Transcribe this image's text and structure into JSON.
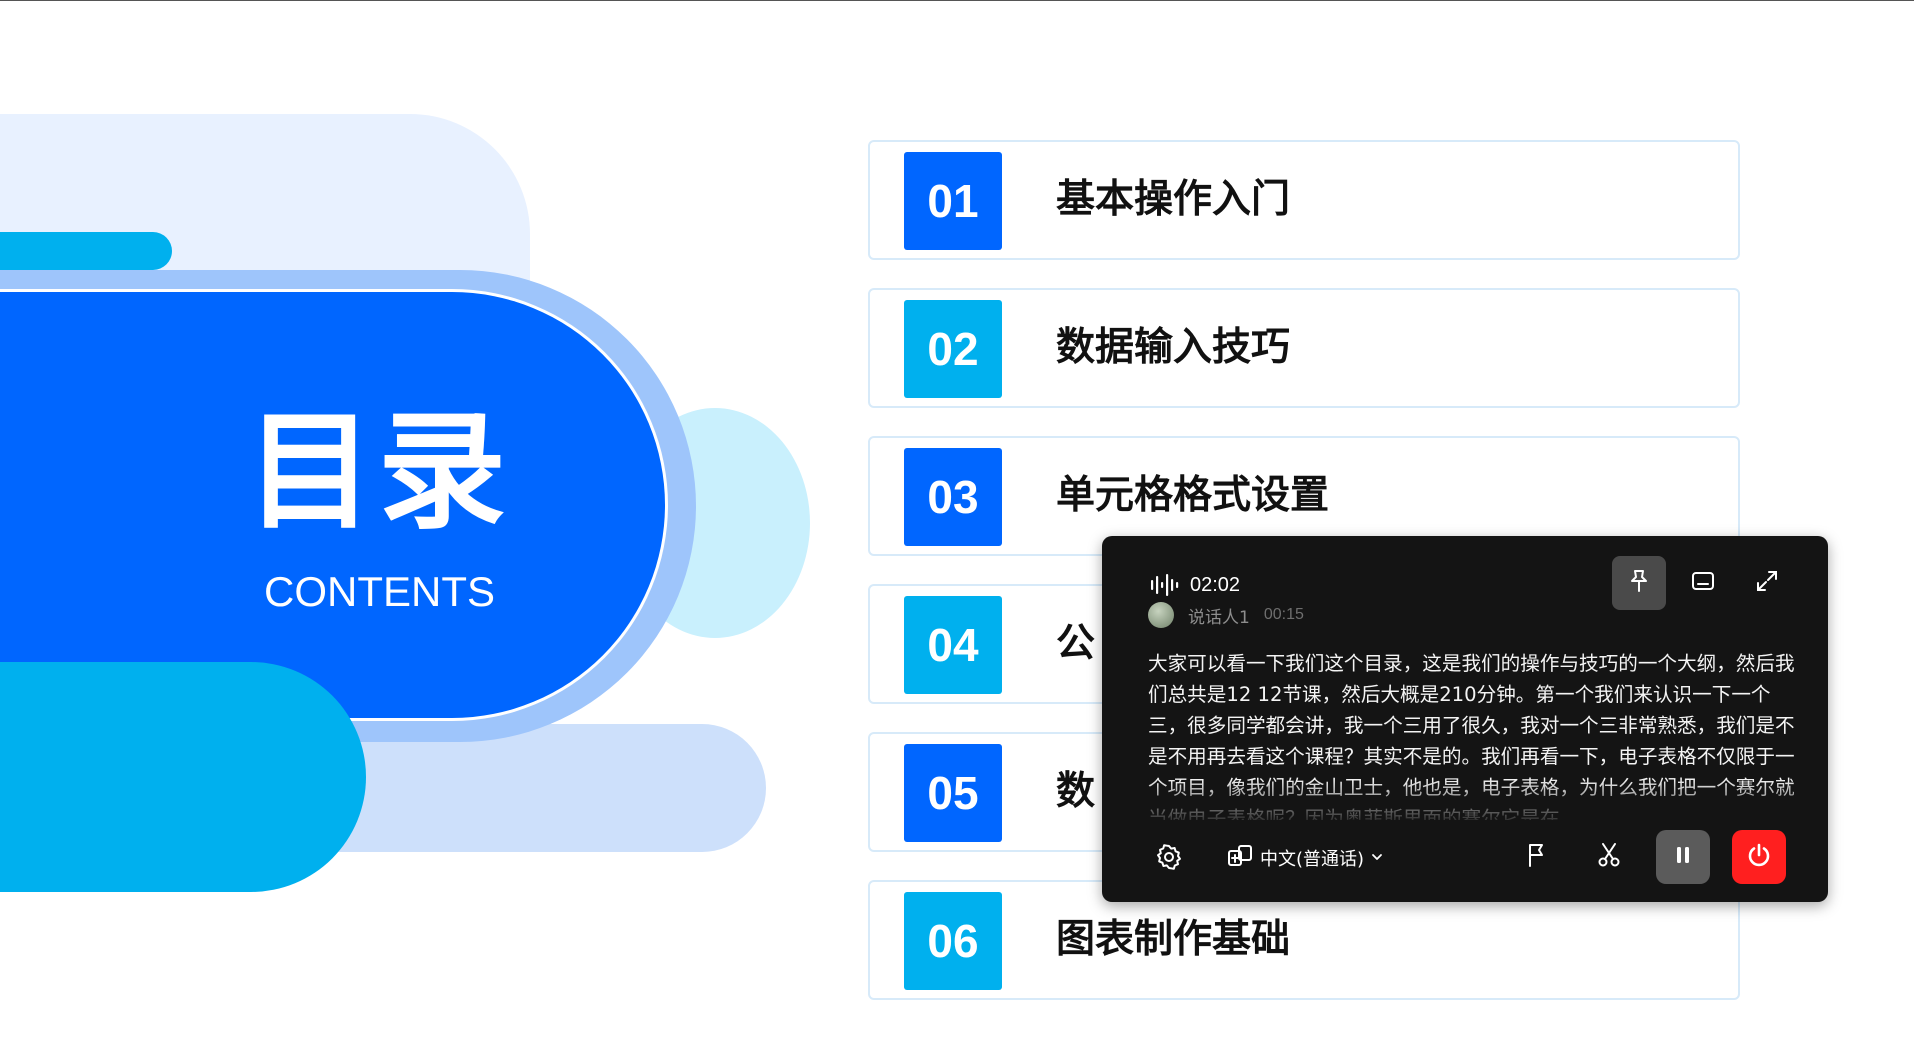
{
  "slide": {
    "title": "目录",
    "subtitle": "CONTENTS",
    "colors": {
      "primary_blue": "#0066ff",
      "cyan": "#00b0ee",
      "light_blue": "#9ec5fb",
      "pale_blue": "#e8f1ff"
    }
  },
  "toc": [
    {
      "number": "01",
      "label": "基本操作入门",
      "color": "#0066ff"
    },
    {
      "number": "02",
      "label": "数据输入技巧",
      "color": "#00b0ee"
    },
    {
      "number": "03",
      "label": "单元格格式设置",
      "color": "#0066ff"
    },
    {
      "number": "04",
      "label": "公",
      "color": "#00b0ee"
    },
    {
      "number": "05",
      "label": "数",
      "color": "#0066ff"
    },
    {
      "number": "06",
      "label": "图表制作基础",
      "color": "#00b0ee"
    }
  ],
  "recorder": {
    "elapsed": "02:02",
    "speaker_name": "说话人1",
    "speaker_time": "00:15",
    "transcript": "大家可以看一下我们这个目录，这是我们的操作与技巧的一个大纲，然后我们总共是12 12节课，然后大概是210分钟。第一个我们来认识一下一个三，很多同学都会讲，我一个三用了很久，我对一个三非常熟悉，我们是不是不用再去看这个课程？其实不是的。我们再看一下，电子表格不仅限于一个项目，像我们的金山卫士，他也是，电子表格，为什么我们把一个赛尔就当做电子表格呢？因为奥菲斯里面的赛尔它是在",
    "language": "中文(普通话)",
    "icons": {
      "waveform": "waveform-icon",
      "pin": "pin-icon",
      "subtitle": "subtitle-icon",
      "expand": "expand-icon",
      "settings": "gear-icon",
      "translate": "translate-icon",
      "flag": "flag-icon",
      "scissors": "scissors-icon",
      "pause": "pause-icon",
      "power": "power-icon"
    },
    "colors": {
      "stop": "#ff1f1f",
      "panel": "#141414"
    }
  }
}
